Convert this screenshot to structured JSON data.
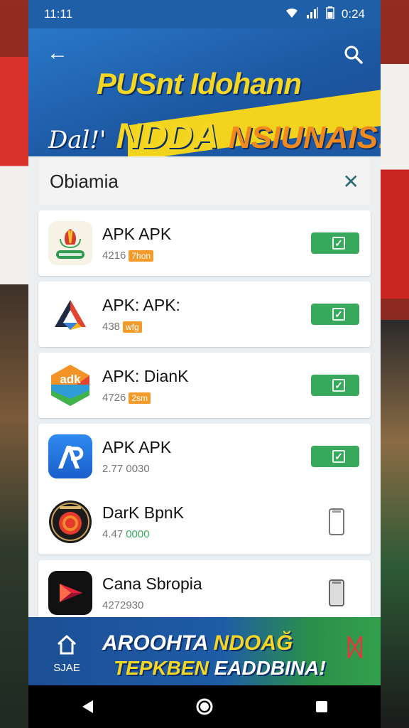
{
  "status_bar": {
    "time": "11:11",
    "clock_right": "0:24"
  },
  "banner": {
    "title": "PUSnt Idohann",
    "script": "Dal!'",
    "big1": "NDDA",
    "big2": "NSIUNAIS!"
  },
  "list": {
    "title": "Obiamia",
    "apps": [
      {
        "name": "APK APK",
        "meta_num": "4216",
        "meta_tag": "7hon",
        "state": "installed",
        "icon": "garuda-logo-icon"
      },
      {
        "name": "APK: APK:",
        "meta_num": "438",
        "meta_tag": "wfg",
        "state": "installed",
        "icon": "triangle-logo-icon"
      },
      {
        "name": "APK: DianK",
        "meta_num": "4726",
        "meta_tag": "2sm",
        "state": "installed",
        "icon": "adk-hexagon-icon"
      },
      {
        "name": "APK APK",
        "meta_num": "2.77 0030",
        "meta_tag": "",
        "state": "installed",
        "icon": "ap-store-icon"
      },
      {
        "name": "DarK BpnK",
        "meta_num": "4.47",
        "meta_green": "0000",
        "state": "device",
        "icon": "dark-circle-icon"
      },
      {
        "name": "Cana Sbropia",
        "meta_num": "4272930",
        "meta_tag": "",
        "state": "device",
        "icon": "red-play-icon"
      }
    ]
  },
  "bottom_banner": {
    "home_label": "SJAE",
    "line1_a": "AROOHTA ",
    "line1_b": "NDOAĞ",
    "line2_a": "TEPKBEN ",
    "line2_b": "EADDBINA!",
    "deco": "ᛞ"
  },
  "colors": {
    "primary_blue": "#1f5fa8",
    "accent_yellow": "#f5d623",
    "install_green": "#38a85c"
  }
}
